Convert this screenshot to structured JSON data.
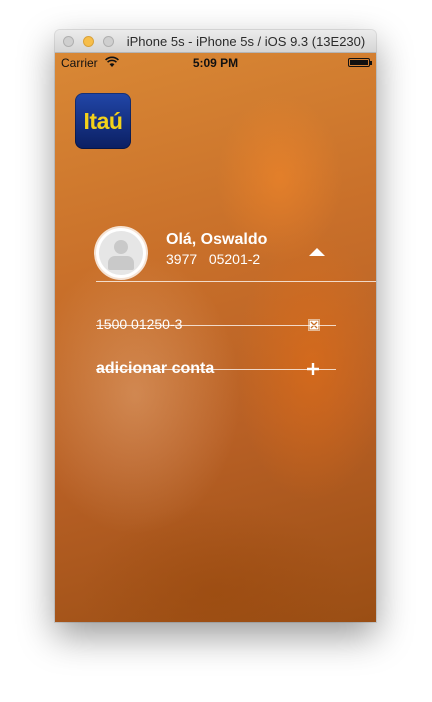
{
  "window": {
    "title": "iPhone 5s - iPhone 5s / iOS 9.3 (13E230)"
  },
  "statusbar": {
    "carrier": "Carrier",
    "time": "5:09 PM"
  },
  "logo": {
    "text": "Itaú"
  },
  "user": {
    "greeting": "Olá, Oswaldo",
    "account": "3977   05201-2"
  },
  "accounts": [
    {
      "number": "1500 01250-3"
    }
  ],
  "add_account": {
    "label": "adicionar conta"
  },
  "icons": {
    "collapse": "chevron-up-icon",
    "remove": "remove-icon",
    "add": "plus-icon",
    "wifi": "wifi-icon",
    "battery": "battery-icon",
    "avatar": "avatar-icon"
  },
  "colors": {
    "background": "#c9702a",
    "logo_blue": "#0b1f62",
    "logo_yellow": "#f3d21a",
    "text": "#ffffff"
  }
}
